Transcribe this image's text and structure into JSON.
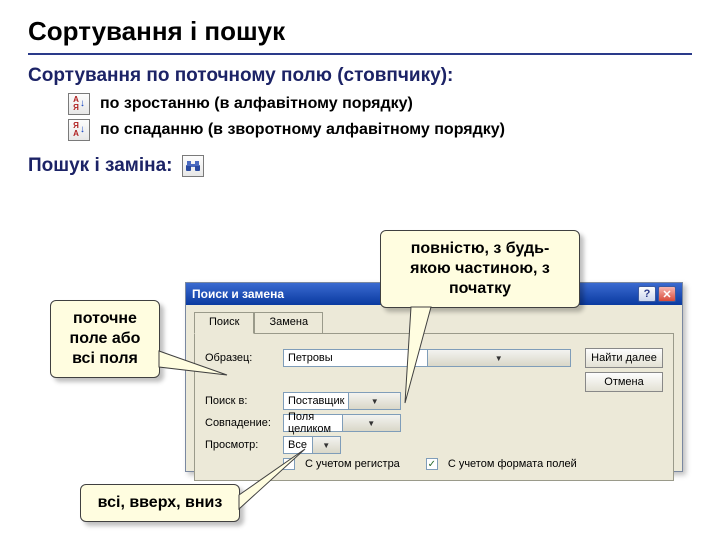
{
  "title": "Сортування і пошук",
  "sort_subtitle": "Сортування по поточному полю (стовпчику):",
  "sort_asc_label": "по зростанню (в алфавітному порядку)",
  "sort_desc_label": "по спаданню (в зворотному алфавітному порядку)",
  "search_replace_subtitle": "Пошук і заміна:",
  "dialog": {
    "title": "Поиск и замена",
    "help_btn": "?",
    "close_btn": "✕",
    "tabs": {
      "search": "Поиск",
      "replace": "Замена"
    },
    "labels": {
      "sample": "Образец:",
      "search_in": "Поиск в:",
      "match": "Совпадение:",
      "direction": "Просмотр:"
    },
    "values": {
      "sample": "Петровы",
      "search_in": "Поставщик",
      "match": "Поля целиком",
      "direction": "Все"
    },
    "checkboxes": {
      "case": "С учетом регистра",
      "format": "С учетом формата полей",
      "format_checked": "✓"
    },
    "buttons": {
      "find_next": "Найти далее",
      "cancel": "Отмена"
    }
  },
  "callouts": {
    "field": "поточне поле або всі поля",
    "match": "повністю, з будь-якою частиною, з початку",
    "direction": "всі, вверх, вниз"
  },
  "icons": {
    "sort_asc_letters_top": "А",
    "sort_asc_letters_bot": "Я",
    "sort_desc_letters_top": "Я",
    "sort_desc_letters_bot": "А",
    "arrow_down": "↓"
  }
}
